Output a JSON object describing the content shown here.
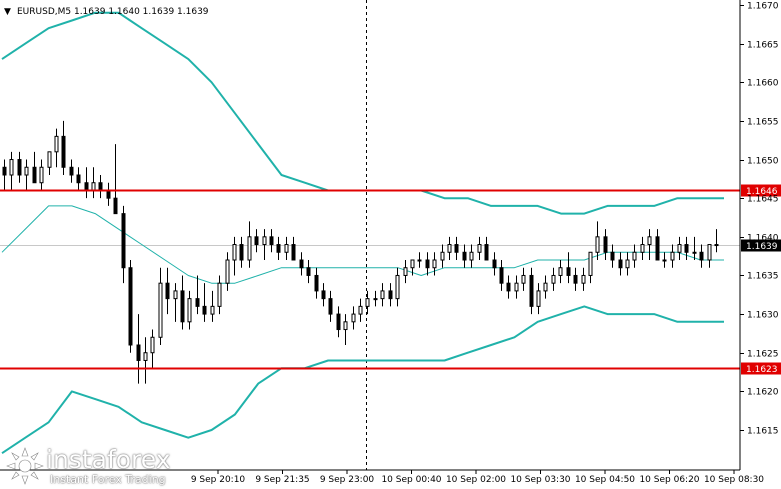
{
  "colors": {
    "background": "#ffffff",
    "candle": "#000000",
    "bollinger": "#20b2aa",
    "level_line": "#e00000",
    "level_label_bg": "#e00000",
    "current_label_bg": "#000000",
    "grid": "#c8c8c8",
    "axis": "#000000"
  },
  "header": {
    "arrow": "▼",
    "symbol_text": "EURUSD,M5  1.1639 1.1640 1.1639 1.1639"
  },
  "watermark": {
    "brand": "instaforex",
    "tagline": "Instant Forex Trading",
    "logo_icon": "instaforex-logo-icon"
  },
  "chart_data": {
    "type": "candlestick",
    "symbol": "EURUSD",
    "timeframe": "M5",
    "ohlc_header": [
      1.1639,
      1.164,
      1.1639,
      1.1639
    ],
    "ylim": [
      1.161,
      1.1671
    ],
    "price_ticks": [
      "1.1670",
      "1.1665",
      "1.1660",
      "1.1655",
      "1.1650",
      "1.1645",
      "1.1640",
      "1.1635",
      "1.1630",
      "1.1625",
      "1.1620",
      "1.1615"
    ],
    "time_ticks": [
      "9 Sep 20:10",
      "9 Sep 21:35",
      "9 Sep 23:00",
      "10 Sep 00:40",
      "10 Sep 02:00",
      "10 Sep 03:30",
      "10 Sep 04:50",
      "10 Sep 06:20",
      "10 Sep 08:30"
    ],
    "levels": [
      {
        "value": 1.1646,
        "label": "1.1646"
      },
      {
        "value": 1.1623,
        "label": "1.1623"
      }
    ],
    "current_price": {
      "value": 1.1639,
      "label": "1.1639"
    },
    "crosshair_time_fraction": 0.495,
    "candles": [
      [
        1.1649,
        1.165,
        1.1646,
        1.1648
      ],
      [
        1.1648,
        1.1651,
        1.1646,
        1.165
      ],
      [
        1.165,
        1.1651,
        1.1647,
        1.1648
      ],
      [
        1.1648,
        1.165,
        1.1646,
        1.1649
      ],
      [
        1.1649,
        1.1651,
        1.1647,
        1.1647
      ],
      [
        1.1647,
        1.165,
        1.1646,
        1.1649
      ],
      [
        1.1649,
        1.1651,
        1.1648,
        1.1651
      ],
      [
        1.1651,
        1.1654,
        1.1649,
        1.1653
      ],
      [
        1.1653,
        1.1655,
        1.1648,
        1.1649
      ],
      [
        1.1649,
        1.165,
        1.1647,
        1.1648
      ],
      [
        1.1648,
        1.1649,
        1.1646,
        1.1647
      ],
      [
        1.1647,
        1.1649,
        1.1645,
        1.1646
      ],
      [
        1.1646,
        1.1649,
        1.1645,
        1.1647
      ],
      [
        1.1647,
        1.1648,
        1.1645,
        1.1646
      ],
      [
        1.1646,
        1.1647,
        1.1644,
        1.1645
      ],
      [
        1.1645,
        1.1652,
        1.1643,
        1.1643
      ],
      [
        1.1643,
        1.1644,
        1.1634,
        1.1636
      ],
      [
        1.1636,
        1.1637,
        1.1625,
        1.1626
      ],
      [
        1.1626,
        1.163,
        1.1621,
        1.1624
      ],
      [
        1.1624,
        1.1627,
        1.1621,
        1.1625
      ],
      [
        1.1625,
        1.1628,
        1.1623,
        1.1627
      ],
      [
        1.1627,
        1.1636,
        1.1626,
        1.1634
      ],
      [
        1.1634,
        1.1636,
        1.163,
        1.1632
      ],
      [
        1.1632,
        1.1634,
        1.1629,
        1.1633
      ],
      [
        1.1633,
        1.1635,
        1.1628,
        1.1629
      ],
      [
        1.1629,
        1.1633,
        1.1628,
        1.1632
      ],
      [
        1.1632,
        1.1635,
        1.163,
        1.1631
      ],
      [
        1.1631,
        1.1634,
        1.1629,
        1.163
      ],
      [
        1.163,
        1.1633,
        1.1629,
        1.1631
      ],
      [
        1.1631,
        1.1635,
        1.163,
        1.1634
      ],
      [
        1.1634,
        1.1638,
        1.1633,
        1.1637
      ],
      [
        1.1637,
        1.164,
        1.1635,
        1.1639
      ],
      [
        1.1639,
        1.164,
        1.1636,
        1.1637
      ],
      [
        1.1637,
        1.1642,
        1.1636,
        1.164
      ],
      [
        1.164,
        1.1641,
        1.1638,
        1.1639
      ],
      [
        1.1639,
        1.1641,
        1.1637,
        1.164
      ],
      [
        1.164,
        1.1641,
        1.1638,
        1.1639
      ],
      [
        1.1639,
        1.164,
        1.1637,
        1.1638
      ],
      [
        1.1638,
        1.164,
        1.1637,
        1.1639
      ],
      [
        1.1639,
        1.164,
        1.1637,
        1.1637
      ],
      [
        1.1637,
        1.1638,
        1.1635,
        1.1636
      ],
      [
        1.1636,
        1.1637,
        1.1634,
        1.1635
      ],
      [
        1.1635,
        1.1636,
        1.1632,
        1.1633
      ],
      [
        1.1633,
        1.1634,
        1.1631,
        1.1632
      ],
      [
        1.1632,
        1.1633,
        1.1629,
        1.163
      ],
      [
        1.163,
        1.1631,
        1.1627,
        1.1628
      ],
      [
        1.1628,
        1.163,
        1.1626,
        1.1629
      ],
      [
        1.1629,
        1.1631,
        1.1628,
        1.163
      ],
      [
        1.163,
        1.1632,
        1.1629,
        1.1631
      ],
      [
        1.1631,
        1.1633,
        1.163,
        1.1632
      ],
      [
        1.1632,
        1.1633,
        1.1631,
        1.1632
      ],
      [
        1.1632,
        1.1634,
        1.1631,
        1.1633
      ],
      [
        1.1633,
        1.1634,
        1.1631,
        1.1632
      ],
      [
        1.1632,
        1.1636,
        1.1631,
        1.1635
      ],
      [
        1.1635,
        1.1637,
        1.1634,
        1.1636
      ],
      [
        1.1636,
        1.1637,
        1.1635,
        1.1637
      ],
      [
        1.1637,
        1.1638,
        1.1636,
        1.1637
      ],
      [
        1.1637,
        1.1638,
        1.1635,
        1.1636
      ],
      [
        1.1636,
        1.1638,
        1.1635,
        1.1637
      ],
      [
        1.1637,
        1.1639,
        1.1636,
        1.1638
      ],
      [
        1.1638,
        1.164,
        1.1637,
        1.1639
      ],
      [
        1.1639,
        1.164,
        1.1637,
        1.1638
      ],
      [
        1.1638,
        1.1639,
        1.1636,
        1.1637
      ],
      [
        1.1637,
        1.1639,
        1.1636,
        1.1638
      ],
      [
        1.1638,
        1.164,
        1.1637,
        1.1639
      ],
      [
        1.1639,
        1.164,
        1.1637,
        1.1637
      ],
      [
        1.1637,
        1.1638,
        1.1635,
        1.1636
      ],
      [
        1.1636,
        1.1637,
        1.1633,
        1.1634
      ],
      [
        1.1634,
        1.1635,
        1.1632,
        1.1633
      ],
      [
        1.1633,
        1.1635,
        1.1632,
        1.1634
      ],
      [
        1.1634,
        1.1636,
        1.1633,
        1.1635
      ],
      [
        1.1635,
        1.1636,
        1.163,
        1.1631
      ],
      [
        1.1631,
        1.1634,
        1.163,
        1.1633
      ],
      [
        1.1633,
        1.1635,
        1.1632,
        1.1634
      ],
      [
        1.1634,
        1.1636,
        1.1633,
        1.1635
      ],
      [
        1.1635,
        1.1637,
        1.1634,
        1.1636
      ],
      [
        1.1636,
        1.1638,
        1.1634,
        1.1635
      ],
      [
        1.1635,
        1.1636,
        1.1633,
        1.1634
      ],
      [
        1.1634,
        1.1636,
        1.1633,
        1.1635
      ],
      [
        1.1635,
        1.1638,
        1.1634,
        1.1638
      ],
      [
        1.1638,
        1.1642,
        1.1637,
        1.164
      ],
      [
        1.164,
        1.1641,
        1.1637,
        1.1638
      ],
      [
        1.1638,
        1.1639,
        1.1636,
        1.1637
      ],
      [
        1.1637,
        1.1638,
        1.1635,
        1.1636
      ],
      [
        1.1636,
        1.1638,
        1.1635,
        1.1637
      ],
      [
        1.1637,
        1.1639,
        1.1636,
        1.1638
      ],
      [
        1.1638,
        1.164,
        1.1637,
        1.1639
      ],
      [
        1.1639,
        1.1641,
        1.1637,
        1.164
      ],
      [
        1.164,
        1.1641,
        1.1637,
        1.1637
      ],
      [
        1.1637,
        1.1638,
        1.1636,
        1.1637
      ],
      [
        1.1637,
        1.1639,
        1.1636,
        1.1638
      ],
      [
        1.1638,
        1.164,
        1.1637,
        1.1639
      ],
      [
        1.1639,
        1.164,
        1.1637,
        1.1638
      ],
      [
        1.1638,
        1.164,
        1.1637,
        1.1638
      ],
      [
        1.1638,
        1.1639,
        1.1636,
        1.1637
      ],
      [
        1.1637,
        1.1639,
        1.1636,
        1.1639
      ],
      [
        1.1639,
        1.1641,
        1.1638,
        1.1639
      ]
    ],
    "bollinger": {
      "upper": [
        1.1663,
        1.1665,
        1.1667,
        1.1668,
        1.1669,
        1.1669,
        1.1667,
        1.1665,
        1.1663,
        1.166,
        1.1656,
        1.1652,
        1.1648,
        1.1647,
        1.1646,
        1.1646,
        1.1646,
        1.1646,
        1.1646,
        1.1645,
        1.1645,
        1.1644,
        1.1644,
        1.1644,
        1.1643,
        1.1643,
        1.1644,
        1.1644,
        1.1644,
        1.1645,
        1.1645,
        1.1645
      ],
      "middle": [
        1.1638,
        1.1641,
        1.1644,
        1.1644,
        1.1643,
        1.1641,
        1.1639,
        1.1637,
        1.1635,
        1.1634,
        1.1634,
        1.1635,
        1.1636,
        1.1636,
        1.1636,
        1.1636,
        1.1636,
        1.1636,
        1.1635,
        1.1636,
        1.1636,
        1.1636,
        1.1636,
        1.1637,
        1.1637,
        1.1637,
        1.1638,
        1.1638,
        1.1638,
        1.1638,
        1.1637,
        1.1637
      ],
      "lower": [
        1.1612,
        1.1614,
        1.1616,
        1.162,
        1.1619,
        1.1618,
        1.1616,
        1.1615,
        1.1614,
        1.1615,
        1.1617,
        1.1621,
        1.1623,
        1.1623,
        1.1624,
        1.1624,
        1.1624,
        1.1624,
        1.1624,
        1.1624,
        1.1625,
        1.1626,
        1.1627,
        1.1629,
        1.163,
        1.1631,
        1.163,
        1.163,
        1.163,
        1.1629,
        1.1629,
        1.1629
      ]
    }
  }
}
